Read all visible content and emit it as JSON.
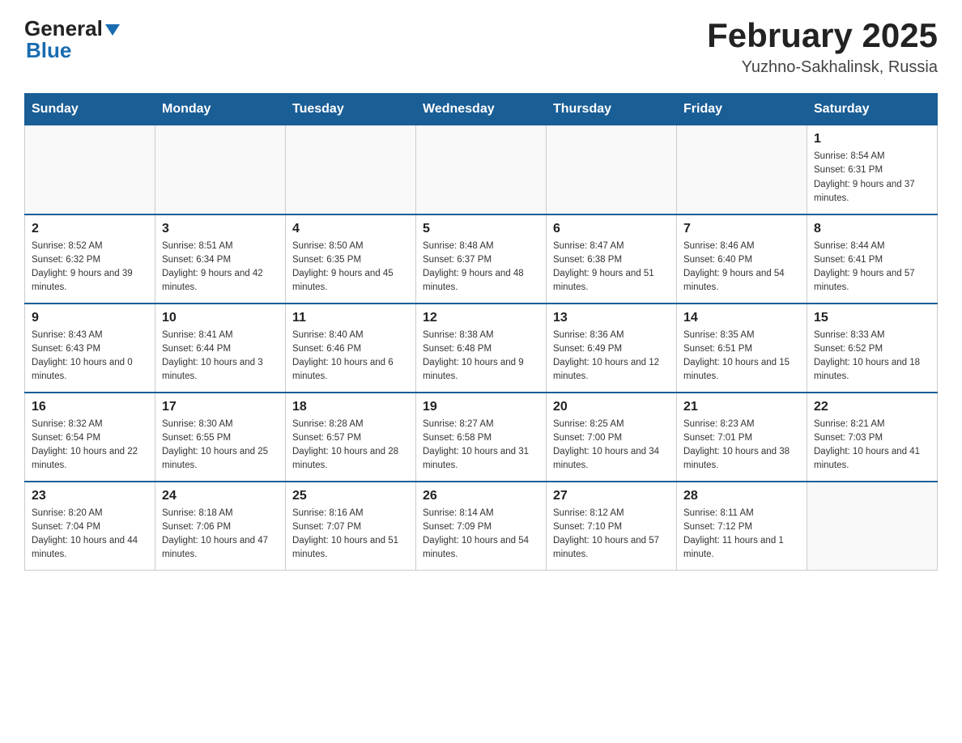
{
  "header": {
    "logo_text1": "General",
    "logo_text2": "Blue",
    "title": "February 2025",
    "subtitle": "Yuzhno-Sakhalinsk, Russia"
  },
  "calendar": {
    "days_of_week": [
      "Sunday",
      "Monday",
      "Tuesday",
      "Wednesday",
      "Thursday",
      "Friday",
      "Saturday"
    ],
    "weeks": [
      [
        {
          "day": "",
          "info": ""
        },
        {
          "day": "",
          "info": ""
        },
        {
          "day": "",
          "info": ""
        },
        {
          "day": "",
          "info": ""
        },
        {
          "day": "",
          "info": ""
        },
        {
          "day": "",
          "info": ""
        },
        {
          "day": "1",
          "info": "Sunrise: 8:54 AM\nSunset: 6:31 PM\nDaylight: 9 hours and 37 minutes."
        }
      ],
      [
        {
          "day": "2",
          "info": "Sunrise: 8:52 AM\nSunset: 6:32 PM\nDaylight: 9 hours and 39 minutes."
        },
        {
          "day": "3",
          "info": "Sunrise: 8:51 AM\nSunset: 6:34 PM\nDaylight: 9 hours and 42 minutes."
        },
        {
          "day": "4",
          "info": "Sunrise: 8:50 AM\nSunset: 6:35 PM\nDaylight: 9 hours and 45 minutes."
        },
        {
          "day": "5",
          "info": "Sunrise: 8:48 AM\nSunset: 6:37 PM\nDaylight: 9 hours and 48 minutes."
        },
        {
          "day": "6",
          "info": "Sunrise: 8:47 AM\nSunset: 6:38 PM\nDaylight: 9 hours and 51 minutes."
        },
        {
          "day": "7",
          "info": "Sunrise: 8:46 AM\nSunset: 6:40 PM\nDaylight: 9 hours and 54 minutes."
        },
        {
          "day": "8",
          "info": "Sunrise: 8:44 AM\nSunset: 6:41 PM\nDaylight: 9 hours and 57 minutes."
        }
      ],
      [
        {
          "day": "9",
          "info": "Sunrise: 8:43 AM\nSunset: 6:43 PM\nDaylight: 10 hours and 0 minutes."
        },
        {
          "day": "10",
          "info": "Sunrise: 8:41 AM\nSunset: 6:44 PM\nDaylight: 10 hours and 3 minutes."
        },
        {
          "day": "11",
          "info": "Sunrise: 8:40 AM\nSunset: 6:46 PM\nDaylight: 10 hours and 6 minutes."
        },
        {
          "day": "12",
          "info": "Sunrise: 8:38 AM\nSunset: 6:48 PM\nDaylight: 10 hours and 9 minutes."
        },
        {
          "day": "13",
          "info": "Sunrise: 8:36 AM\nSunset: 6:49 PM\nDaylight: 10 hours and 12 minutes."
        },
        {
          "day": "14",
          "info": "Sunrise: 8:35 AM\nSunset: 6:51 PM\nDaylight: 10 hours and 15 minutes."
        },
        {
          "day": "15",
          "info": "Sunrise: 8:33 AM\nSunset: 6:52 PM\nDaylight: 10 hours and 18 minutes."
        }
      ],
      [
        {
          "day": "16",
          "info": "Sunrise: 8:32 AM\nSunset: 6:54 PM\nDaylight: 10 hours and 22 minutes."
        },
        {
          "day": "17",
          "info": "Sunrise: 8:30 AM\nSunset: 6:55 PM\nDaylight: 10 hours and 25 minutes."
        },
        {
          "day": "18",
          "info": "Sunrise: 8:28 AM\nSunset: 6:57 PM\nDaylight: 10 hours and 28 minutes."
        },
        {
          "day": "19",
          "info": "Sunrise: 8:27 AM\nSunset: 6:58 PM\nDaylight: 10 hours and 31 minutes."
        },
        {
          "day": "20",
          "info": "Sunrise: 8:25 AM\nSunset: 7:00 PM\nDaylight: 10 hours and 34 minutes."
        },
        {
          "day": "21",
          "info": "Sunrise: 8:23 AM\nSunset: 7:01 PM\nDaylight: 10 hours and 38 minutes."
        },
        {
          "day": "22",
          "info": "Sunrise: 8:21 AM\nSunset: 7:03 PM\nDaylight: 10 hours and 41 minutes."
        }
      ],
      [
        {
          "day": "23",
          "info": "Sunrise: 8:20 AM\nSunset: 7:04 PM\nDaylight: 10 hours and 44 minutes."
        },
        {
          "day": "24",
          "info": "Sunrise: 8:18 AM\nSunset: 7:06 PM\nDaylight: 10 hours and 47 minutes."
        },
        {
          "day": "25",
          "info": "Sunrise: 8:16 AM\nSunset: 7:07 PM\nDaylight: 10 hours and 51 minutes."
        },
        {
          "day": "26",
          "info": "Sunrise: 8:14 AM\nSunset: 7:09 PM\nDaylight: 10 hours and 54 minutes."
        },
        {
          "day": "27",
          "info": "Sunrise: 8:12 AM\nSunset: 7:10 PM\nDaylight: 10 hours and 57 minutes."
        },
        {
          "day": "28",
          "info": "Sunrise: 8:11 AM\nSunset: 7:12 PM\nDaylight: 11 hours and 1 minute."
        },
        {
          "day": "",
          "info": ""
        }
      ]
    ]
  }
}
